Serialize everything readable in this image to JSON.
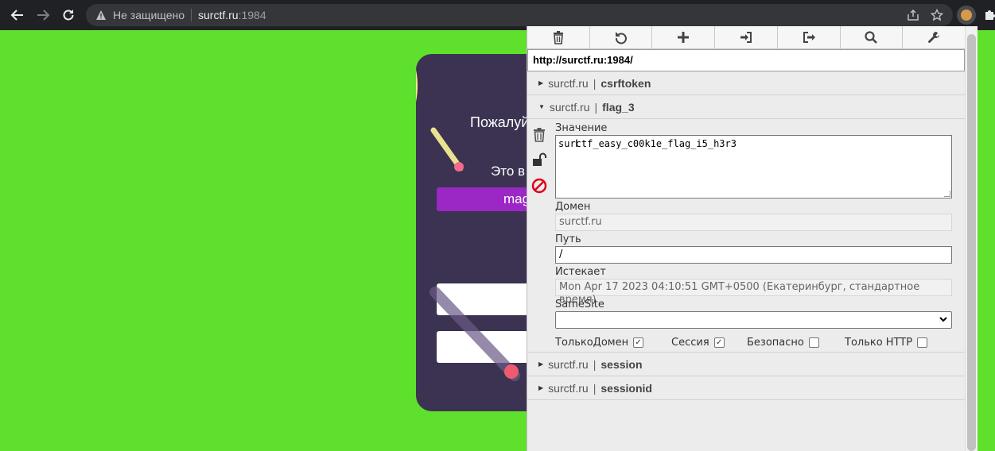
{
  "browser": {
    "security_label": "Не защищено",
    "host": "surctf.ru",
    "port": ":1984"
  },
  "page": {
    "greeting_partial": "Пожалуй",
    "line2_partial": "Это в",
    "button_partial": "mag"
  },
  "panel": {
    "url": "http://surctf.ru:1984/",
    "cookies": [
      {
        "domain": "surctf.ru",
        "name": "csrftoken",
        "expanded": false
      },
      {
        "domain": "surctf.ru",
        "name": "flag_3",
        "expanded": true
      },
      {
        "domain": "surctf.ru",
        "name": "session",
        "expanded": false
      },
      {
        "domain": "surctf.ru",
        "name": "sessionid",
        "expanded": false
      }
    ],
    "separator": "|",
    "editor": {
      "value_label": "Значение",
      "value": "surctf_easy_c00k1e_flag_i5_h3r3",
      "domain_label": "Домен",
      "domain": "surctf.ru",
      "path_label": "Путь",
      "path": "/",
      "expires_label": "Истекает",
      "expires": "Mon Apr 17 2023 04:10:51 GMT+0500 (Екатеринбург, стандартное время)",
      "samesite_label": "SameSite",
      "samesite": "",
      "host_only_label": "ТолькоДомен",
      "host_only": true,
      "session_label": "Сессия",
      "session": true,
      "secure_label": "Безопасно",
      "secure": false,
      "http_only_label": "Только HTTP",
      "http_only": false
    }
  },
  "colors": {
    "page_bg": "#5fe02d",
    "card_bg": "#3c3352",
    "accent_button": "#9b27c4",
    "block_icon": "#e0001b"
  }
}
